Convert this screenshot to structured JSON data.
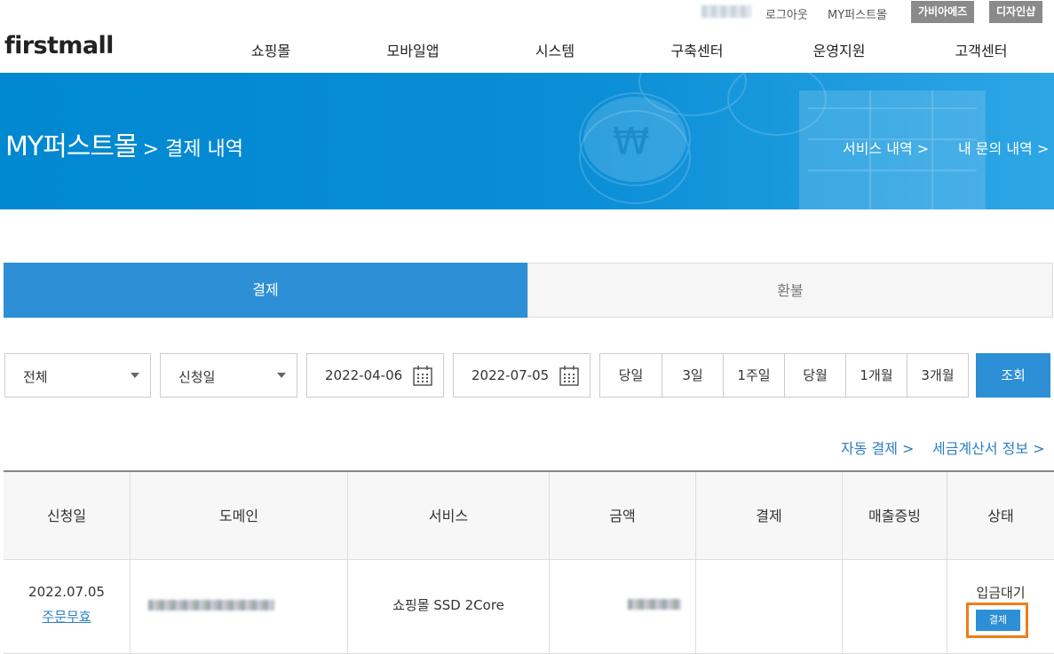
{
  "util": {
    "logout": "로그아웃",
    "mypage": "MY퍼스트몰",
    "btn_gabia": "가비아에즈",
    "btn_design": "디자인샵"
  },
  "header": {
    "logo": "firstmall",
    "nav": [
      "쇼핑몰",
      "모바일앱",
      "시스템",
      "구축센터",
      "운영지원",
      "고객센터"
    ]
  },
  "banner": {
    "title": "MY퍼스트몰",
    "subtitle": "> 결제 내역",
    "links": [
      "서비스 내역 >",
      "내 문의 내역 >"
    ]
  },
  "tabs": [
    {
      "label": "결제",
      "active": true
    },
    {
      "label": "환불",
      "active": false
    }
  ],
  "filters": {
    "type_select": "전체",
    "date_type_select": "신청일",
    "start_date": "2022-04-06",
    "end_date": "2022-07-05",
    "periods": [
      "당일",
      "3일",
      "1주일",
      "당월",
      "1개월",
      "3개월"
    ],
    "search_label": "조회"
  },
  "links": {
    "auto_pay": "자동 결제 >",
    "tax_invoice": "세금계산서 정보 >"
  },
  "table": {
    "headers": [
      "신청일",
      "도메인",
      "서비스",
      "금액",
      "결제",
      "매출증빙",
      "상태"
    ],
    "rows": [
      {
        "date": "2022.07.05",
        "cancel": "주문무효",
        "service": "쇼핑몰 SSD 2Core",
        "status": "입금대기",
        "pay_button": "결제"
      }
    ]
  },
  "colors": {
    "primary": "#2d8fd6",
    "banner": "#0088d0",
    "highlight": "#f07d1a"
  }
}
